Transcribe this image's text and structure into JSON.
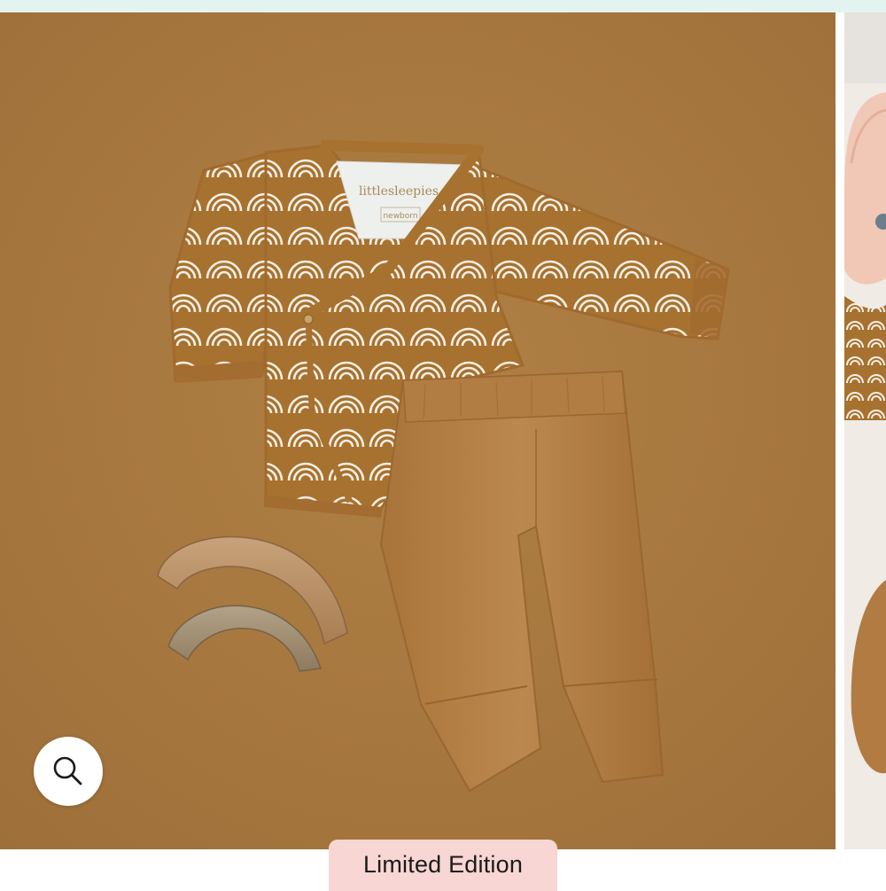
{
  "badge": {
    "label": "Limited Edition"
  },
  "zoom": {
    "icon": "magnifier-icon",
    "label": "Zoom image"
  },
  "photo": {
    "shirt_tag_brand": "littlesleepies",
    "shirt_tag_size": "newborn"
  },
  "colors": {
    "backdrop": "#a9793f",
    "shirt_print": "#a7712f",
    "pants": "#b7834a",
    "badge_background": "#f8d6d3",
    "top_strip": "#e3f4f0"
  }
}
